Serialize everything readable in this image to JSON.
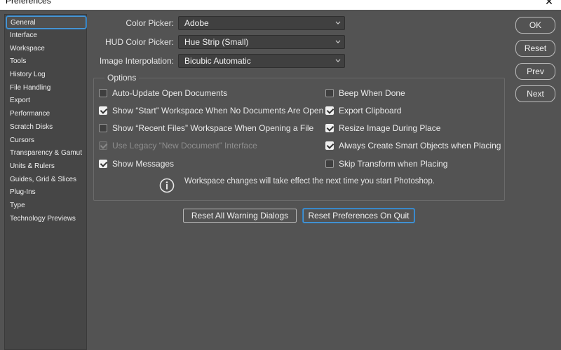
{
  "window": {
    "title": "Preferences",
    "close_glyph": "✕"
  },
  "sidebar": {
    "items": [
      {
        "label": "General",
        "active": true
      },
      {
        "label": "Interface"
      },
      {
        "label": "Workspace"
      },
      {
        "label": "Tools"
      },
      {
        "label": "History Log"
      },
      {
        "label": "File Handling"
      },
      {
        "label": "Export"
      },
      {
        "label": "Performance"
      },
      {
        "label": "Scratch Disks"
      },
      {
        "label": "Cursors"
      },
      {
        "label": "Transparency & Gamut"
      },
      {
        "label": "Units & Rulers"
      },
      {
        "label": "Guides, Grid & Slices"
      },
      {
        "label": "Plug-Ins"
      },
      {
        "label": "Type"
      },
      {
        "label": "Technology Previews"
      }
    ]
  },
  "fields": {
    "color_picker": {
      "label": "Color Picker:",
      "value": "Adobe"
    },
    "hud_color_picker": {
      "label": "HUD Color Picker:",
      "value": "Hue Strip (Small)"
    },
    "image_interpolation": {
      "label": "Image Interpolation:",
      "value": "Bicubic Automatic"
    }
  },
  "options": {
    "legend": "Options",
    "left": [
      {
        "label": "Auto-Update Open Documents",
        "checked": false,
        "disabled": false
      },
      {
        "label": "Show “Start” Workspace When No Documents Are Open",
        "checked": true,
        "disabled": false
      },
      {
        "label": "Show “Recent Files” Workspace When Opening a File",
        "checked": false,
        "disabled": false
      },
      {
        "label": "Use Legacy “New Document” Interface",
        "checked": true,
        "disabled": true
      },
      {
        "label": "Show Messages",
        "checked": true,
        "disabled": false
      }
    ],
    "right": [
      {
        "label": "Beep When Done",
        "checked": false,
        "disabled": false
      },
      {
        "label": "Export Clipboard",
        "checked": true,
        "disabled": false
      },
      {
        "label": "Resize Image During Place",
        "checked": true,
        "disabled": false
      },
      {
        "label": "Always Create Smart Objects when Placing",
        "checked": true,
        "disabled": false
      },
      {
        "label": "Skip Transform when Placing",
        "checked": false,
        "disabled": false
      }
    ],
    "info_text": "Workspace changes will take effect the next time you start Photoshop."
  },
  "buttons": {
    "reset_warnings": "Reset All Warning Dialogs",
    "reset_prefs": "Reset Preferences On Quit",
    "ok": "OK",
    "reset": "Reset",
    "prev": "Prev",
    "next": "Next"
  },
  "colors": {
    "accent": "#4a9ad8",
    "background": "#535353",
    "sidebar": "#464646"
  }
}
